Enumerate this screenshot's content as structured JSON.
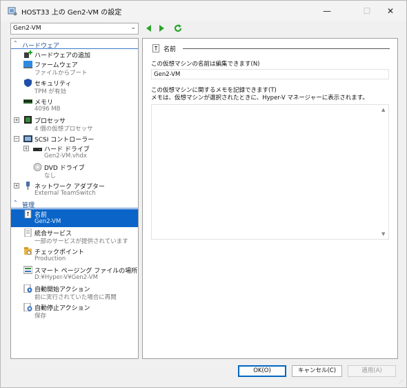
{
  "window": {
    "title": "HOST33 上の Gen2-VM の設定",
    "minimize": "—",
    "maximize": "☐",
    "close": "✕"
  },
  "vm_selector": {
    "value": "Gen2-VM",
    "chevron": "⌄"
  },
  "nav": {
    "back_icon": "back-arrow-icon",
    "forward_icon": "forward-arrow-icon",
    "refresh_icon": "refresh-icon"
  },
  "sidebar": {
    "hardware_header": "ハードウェア",
    "management_header": "管理",
    "hardware_items": [
      {
        "label": "ハードウェアの追加",
        "sub": "",
        "icon": "add-hardware-icon"
      },
      {
        "label": "ファームウェア",
        "sub": "ファイルからブート",
        "icon": "firmware-icon"
      },
      {
        "label": "セキュリティ",
        "sub": "TPM が有効",
        "icon": "shield-icon"
      },
      {
        "label": "メモリ",
        "sub": "4096 MB",
        "icon": "memory-icon"
      },
      {
        "label": "プロセッサ",
        "sub": "4 個の仮想プロセッサ",
        "icon": "processor-icon"
      },
      {
        "label": "SCSI コントローラー",
        "sub": "",
        "icon": "scsi-controller-icon"
      },
      {
        "label": "ハード ドライブ",
        "sub": "Gen2-VM.vhdx",
        "icon": "hard-drive-icon"
      },
      {
        "label": "DVD ドライブ",
        "sub": "なし",
        "icon": "dvd-drive-icon"
      },
      {
        "label": "ネットワーク アダプター",
        "sub": "External TeamSwitch",
        "icon": "network-adapter-icon"
      }
    ],
    "management_items": [
      {
        "label": "名前",
        "sub": "Gen2-VM",
        "icon": "name-icon"
      },
      {
        "label": "統合サービス",
        "sub": "一部のサービスが提供されています",
        "icon": "integration-services-icon"
      },
      {
        "label": "チェックポイント",
        "sub": "Production",
        "icon": "checkpoint-icon"
      },
      {
        "label": "スマート ページング ファイルの場所",
        "sub": "D:¥Hyper-V¥Gen2-VM",
        "icon": "smart-paging-icon"
      },
      {
        "label": "自動開始アクション",
        "sub": "前に実行されていた場合に再開",
        "icon": "auto-start-icon"
      },
      {
        "label": "自動停止アクション",
        "sub": "保存",
        "icon": "auto-stop-icon"
      }
    ]
  },
  "main": {
    "group_title": "名前",
    "name_label": "この仮想マシンの名前は編集できます(N)",
    "name_value": "Gen2-VM",
    "notes_label_1": "この仮想マシンに関するメモを記録できます(T)",
    "notes_label_2": "メモは、仮想マシンが選択されたときに、Hyper-V マネージャーに表示されます。",
    "notes_value": ""
  },
  "buttons": {
    "ok": "OK(O)",
    "cancel": "キャンセル(C)",
    "apply": "適用(A)"
  },
  "colors": {
    "selection": "#0b65c8",
    "section_header": "#1c4f94",
    "nav_green": "#2aa52a"
  }
}
